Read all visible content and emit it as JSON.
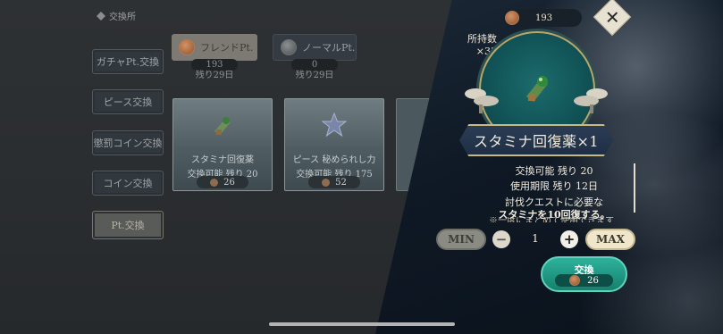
{
  "screen": {
    "title": "交換所"
  },
  "sidebar": {
    "items": [
      {
        "label": "ガチャPt.交換"
      },
      {
        "label": "ピース交換"
      },
      {
        "label": "懲罰コイン交換"
      },
      {
        "label": "コイン交換"
      },
      {
        "label": "Pt.交換",
        "active": true
      }
    ]
  },
  "pt_tabs": [
    {
      "label": "フレンドPt.",
      "count": "193",
      "remaining": "残り29日",
      "icon": "friend-pt-coin-icon",
      "color": "#d08a58"
    },
    {
      "label": "ノーマルPt.",
      "count": "0",
      "remaining": "残り29日",
      "icon": "normal-pt-coin-icon",
      "color": "#8c8f91"
    }
  ],
  "items": [
    {
      "name": "スタミナ回復薬",
      "avail": "交換可能  残り 20",
      "cost": "26",
      "icon": "stamina-potion-icon"
    },
    {
      "name": "ピース 秘められし力",
      "avail": "交換可能  残り 175",
      "cost": "52",
      "icon": "star-piece-icon"
    }
  ],
  "detail": {
    "top_count": "193",
    "owned_label": "所持数",
    "owned_value": "×33",
    "title": "スタミナ回復薬×1",
    "avail": "交換可能  残り 20",
    "expiry": "使用期限  残り 12日",
    "desc_line1": "討伐クエストに必要な",
    "desc_line2": "スタミナを10回復する。",
    "desc_cut": "※一度にまとめて使用できます",
    "min_label": "MIN",
    "max_label": "MAX",
    "quantity": "1",
    "exchange_label": "交換",
    "exchange_cost": "26",
    "accent": "#1fa28b"
  }
}
